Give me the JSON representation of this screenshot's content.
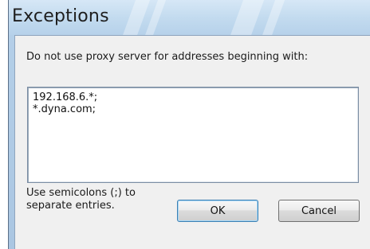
{
  "window": {
    "title": "Exceptions"
  },
  "dialog": {
    "instruction": "Do not use proxy server for addresses beginning with:",
    "entries": [
      "192.168.6.*;",
      "*.dyna.com;"
    ],
    "hint_lines": [
      "Use semicolons (;) to",
      "separate entries."
    ]
  },
  "buttons": {
    "ok_label": "OK",
    "cancel_label": "Cancel"
  },
  "colors": {
    "title_bar": "#c3dbef",
    "client_background": "#f0f0f0",
    "default_button_border": "#3c7fb1"
  }
}
